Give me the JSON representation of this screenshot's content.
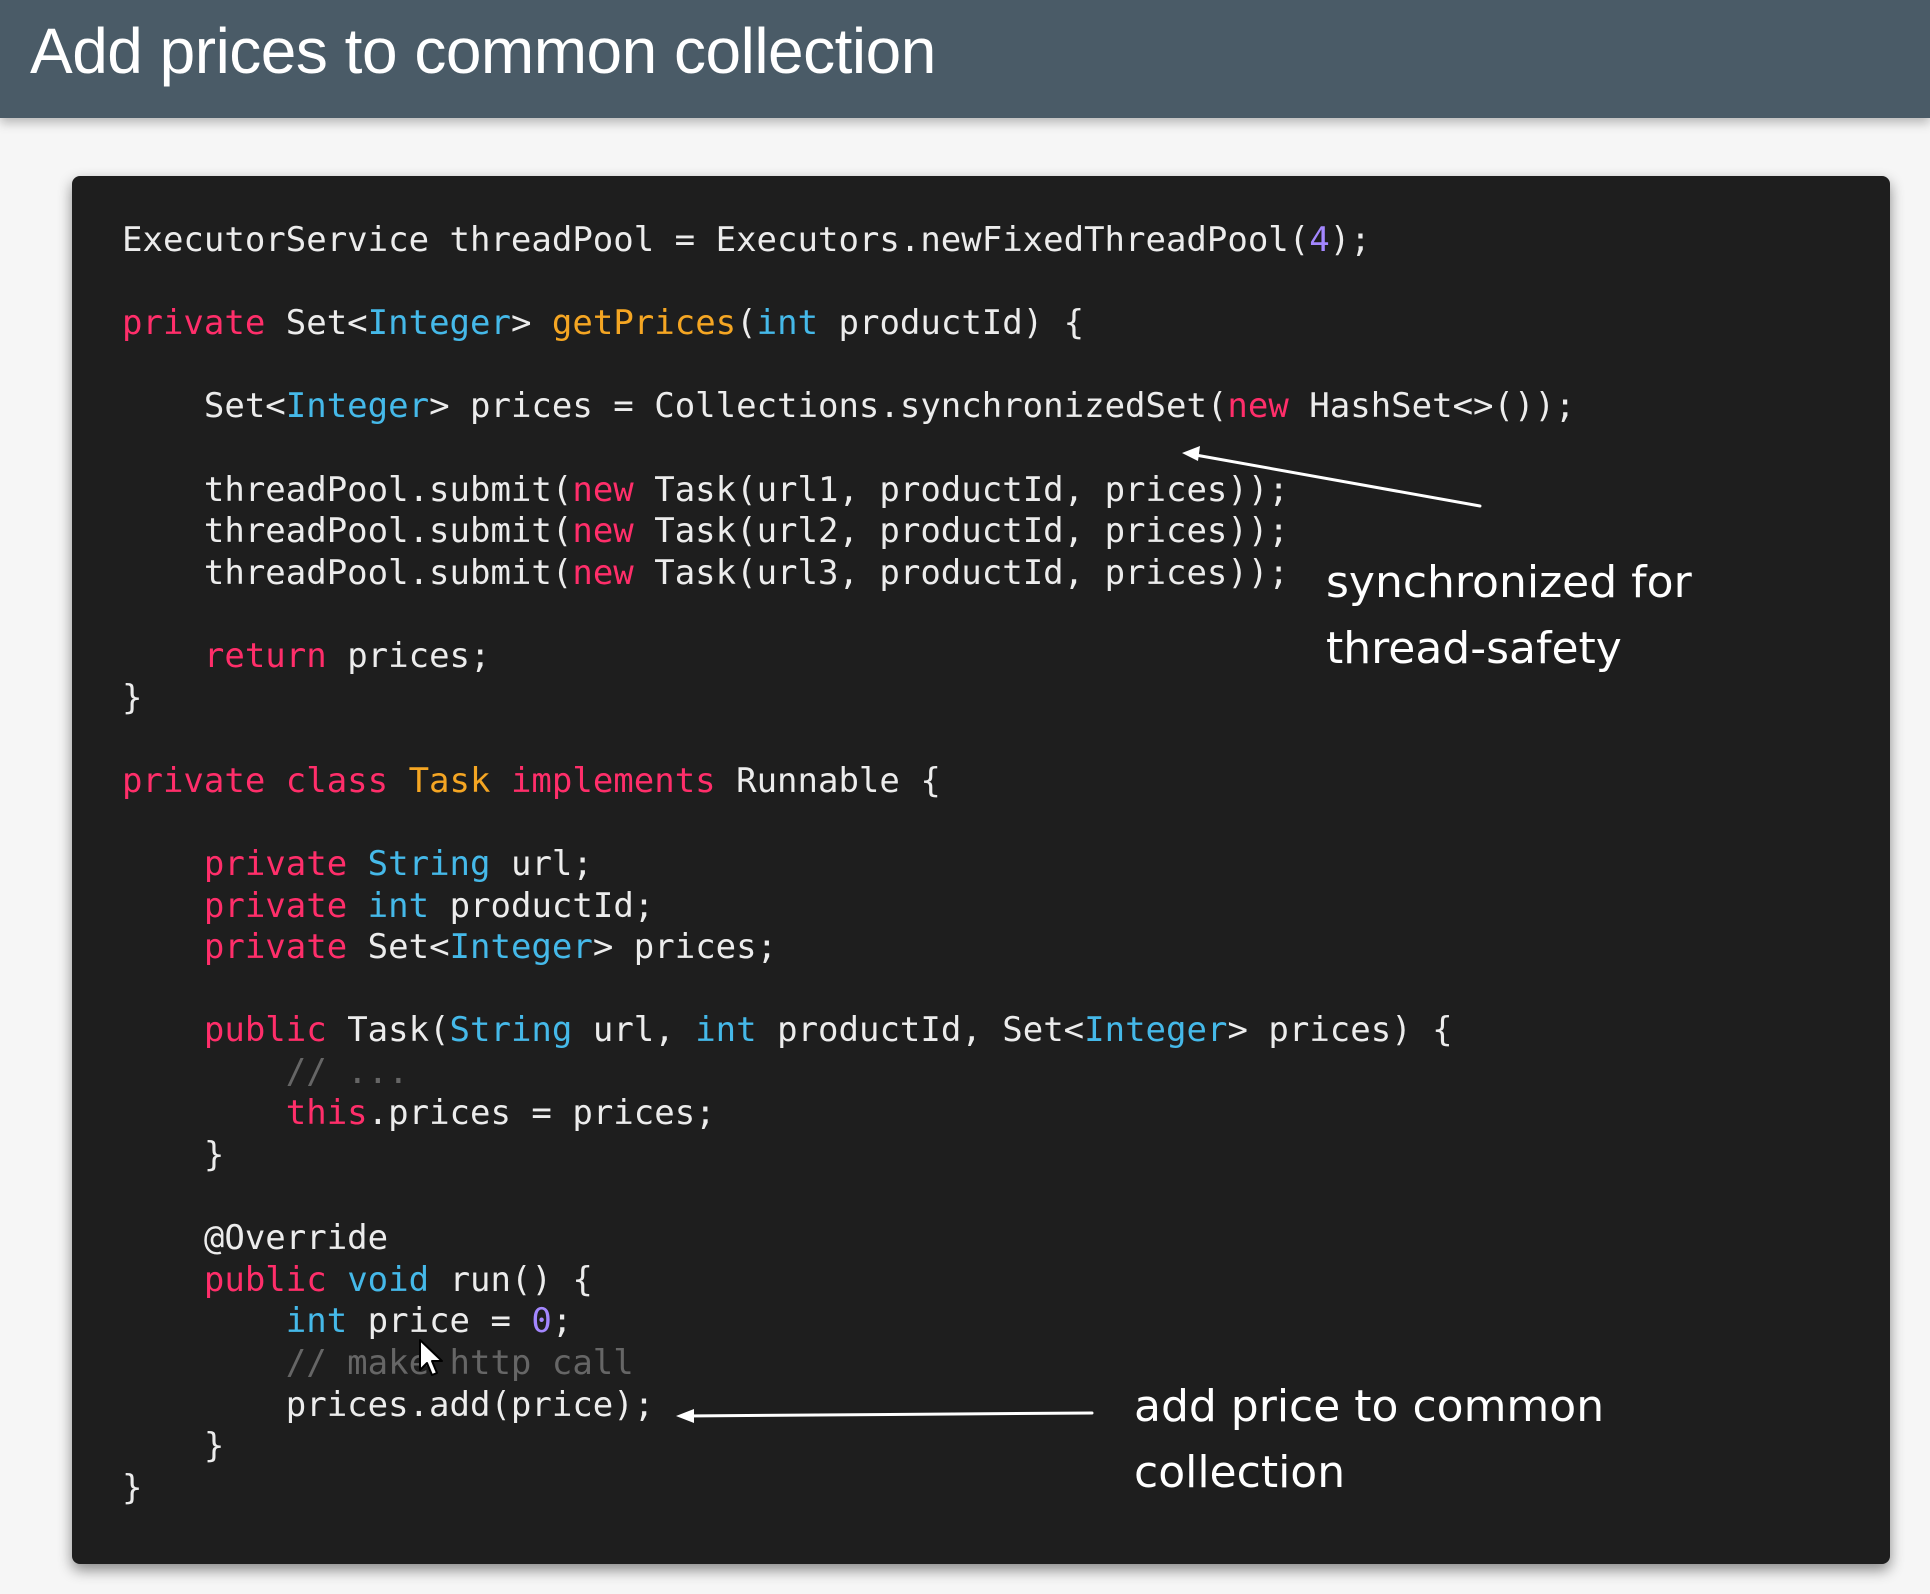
{
  "slide": {
    "title": "Add prices to common collection"
  },
  "code": {
    "lines": [
      [
        {
          "t": "ExecutorService threadPool = Executors.newFixedThreadPool(",
          "c": ""
        },
        {
          "t": "4",
          "c": "num"
        },
        {
          "t": ");",
          "c": ""
        }
      ],
      [],
      [
        {
          "t": "private",
          "c": "kw"
        },
        {
          "t": " Set<",
          "c": ""
        },
        {
          "t": "Integer",
          "c": "ty"
        },
        {
          "t": "> ",
          "c": ""
        },
        {
          "t": "getPrices",
          "c": "fn"
        },
        {
          "t": "(",
          "c": ""
        },
        {
          "t": "int",
          "c": "ty"
        },
        {
          "t": " productId) {",
          "c": ""
        }
      ],
      [],
      [
        {
          "t": "    Set<",
          "c": ""
        },
        {
          "t": "Integer",
          "c": "ty"
        },
        {
          "t": "> prices = Collections.synchronizedSet(",
          "c": ""
        },
        {
          "t": "new",
          "c": "kw"
        },
        {
          "t": " HashSet<>());",
          "c": ""
        }
      ],
      [],
      [
        {
          "t": "    threadPool.submit(",
          "c": ""
        },
        {
          "t": "new",
          "c": "kw"
        },
        {
          "t": " Task(url1, productId, prices));",
          "c": ""
        }
      ],
      [
        {
          "t": "    threadPool.submit(",
          "c": ""
        },
        {
          "t": "new",
          "c": "kw"
        },
        {
          "t": " Task(url2, productId, prices));",
          "c": ""
        }
      ],
      [
        {
          "t": "    threadPool.submit(",
          "c": ""
        },
        {
          "t": "new",
          "c": "kw"
        },
        {
          "t": " Task(url3, productId, prices));",
          "c": ""
        }
      ],
      [],
      [
        {
          "t": "    ",
          "c": ""
        },
        {
          "t": "return",
          "c": "kw"
        },
        {
          "t": " prices;",
          "c": ""
        }
      ],
      [
        {
          "t": "}",
          "c": ""
        }
      ],
      [],
      [
        {
          "t": "private class ",
          "c": "kw"
        },
        {
          "t": "Task",
          "c": "fn"
        },
        {
          "t": " implements",
          "c": "kw"
        },
        {
          "t": " Runnable {",
          "c": ""
        }
      ],
      [],
      [
        {
          "t": "    ",
          "c": ""
        },
        {
          "t": "private",
          "c": "kw"
        },
        {
          "t": " ",
          "c": ""
        },
        {
          "t": "String",
          "c": "ty"
        },
        {
          "t": " url;",
          "c": ""
        }
      ],
      [
        {
          "t": "    ",
          "c": ""
        },
        {
          "t": "private",
          "c": "kw"
        },
        {
          "t": " ",
          "c": ""
        },
        {
          "t": "int",
          "c": "ty"
        },
        {
          "t": " productId;",
          "c": ""
        }
      ],
      [
        {
          "t": "    ",
          "c": ""
        },
        {
          "t": "private",
          "c": "kw"
        },
        {
          "t": " Set<",
          "c": ""
        },
        {
          "t": "Integer",
          "c": "ty"
        },
        {
          "t": "> prices;",
          "c": ""
        }
      ],
      [],
      [
        {
          "t": "    ",
          "c": ""
        },
        {
          "t": "public",
          "c": "kw"
        },
        {
          "t": " Task(",
          "c": ""
        },
        {
          "t": "String",
          "c": "ty"
        },
        {
          "t": " url, ",
          "c": ""
        },
        {
          "t": "int",
          "c": "ty"
        },
        {
          "t": " productId, Set<",
          "c": ""
        },
        {
          "t": "Integer",
          "c": "ty"
        },
        {
          "t": "> prices) {",
          "c": ""
        }
      ],
      [
        {
          "t": "        // ...",
          "c": "cm"
        }
      ],
      [
        {
          "t": "        ",
          "c": ""
        },
        {
          "t": "this",
          "c": "kw"
        },
        {
          "t": ".prices = prices;",
          "c": ""
        }
      ],
      [
        {
          "t": "    }",
          "c": ""
        }
      ],
      [],
      [
        {
          "t": "    @Override",
          "c": "ann"
        }
      ],
      [
        {
          "t": "    ",
          "c": ""
        },
        {
          "t": "public",
          "c": "kw"
        },
        {
          "t": " ",
          "c": ""
        },
        {
          "t": "void",
          "c": "ty"
        },
        {
          "t": " run() {",
          "c": ""
        }
      ],
      [
        {
          "t": "        ",
          "c": ""
        },
        {
          "t": "int",
          "c": "ty"
        },
        {
          "t": " price = ",
          "c": ""
        },
        {
          "t": "0",
          "c": "num"
        },
        {
          "t": ";",
          "c": ""
        }
      ],
      [
        {
          "t": "        // make http call",
          "c": "cm"
        }
      ],
      [
        {
          "t": "        prices.add(price);",
          "c": ""
        }
      ],
      [
        {
          "t": "    }",
          "c": ""
        }
      ],
      [
        {
          "t": "}",
          "c": ""
        }
      ]
    ]
  },
  "annotations": {
    "sync": {
      "line1": "synchronized for",
      "line2": "thread-safety"
    },
    "add": {
      "line1": "add price to common",
      "line2": "collection"
    }
  },
  "colors": {
    "keyword": "#ff2e6a",
    "type": "#45b9e9",
    "function": "#f5a623",
    "number": "#a487ff",
    "comment": "#666666",
    "header_bg": "#4a5b67",
    "panel_bg": "#1e1e1e"
  }
}
